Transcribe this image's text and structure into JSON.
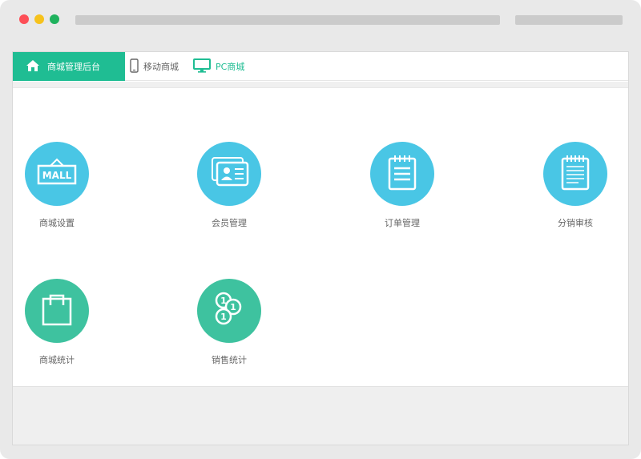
{
  "nav": {
    "admin_label": "商城管理后台",
    "mobile_label": "移动商城",
    "pc_label": "PC商城"
  },
  "tiles": [
    {
      "label": "商城设置",
      "icon": "mall-sign-icon",
      "color": "#49c6e5"
    },
    {
      "label": "会员管理",
      "icon": "member-card-icon",
      "color": "#49c6e5"
    },
    {
      "label": "订单管理",
      "icon": "order-list-icon",
      "color": "#49c6e5"
    },
    {
      "label": "分销审核",
      "icon": "notepad-icon",
      "color": "#49c6e5"
    },
    {
      "label": "商城统计",
      "icon": "shopping-bag-icon",
      "color": "#3ec29f"
    },
    {
      "label": "销售统计",
      "icon": "coins-icon",
      "color": "#3ec29f"
    }
  ],
  "mall_sign_text": "MALL",
  "colors": {
    "accent": "#1fbd93",
    "tile_blue": "#49c6e5",
    "tile_green": "#3ec29f"
  }
}
